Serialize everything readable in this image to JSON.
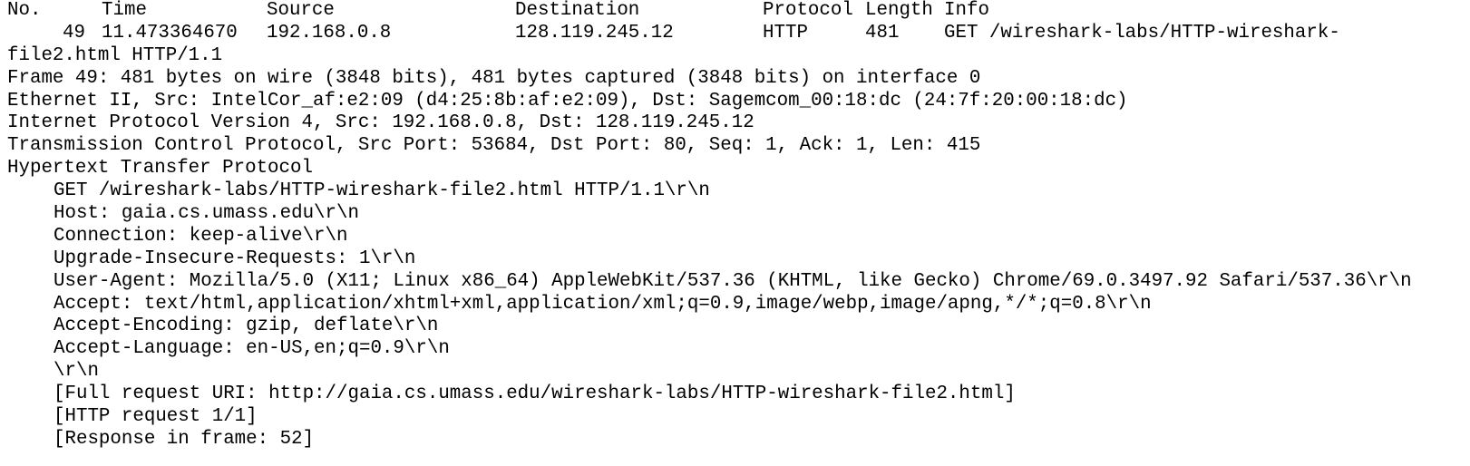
{
  "summary": {
    "headers": {
      "no": "No.",
      "time": "Time",
      "source": "Source",
      "destination": "Destination",
      "protocol": "Protocol",
      "length": "Length",
      "info": "Info"
    },
    "row": {
      "no": "49",
      "time": "11.473364670",
      "source": "192.168.0.8",
      "destination": "128.119.245.12",
      "protocol": "HTTP",
      "length": "481",
      "info": "GET /wireshark-labs/HTTP-wireshark-",
      "info_wrap": "file2.html HTTP/1.1"
    }
  },
  "details": {
    "frame": "Frame 49: 481 bytes on wire (3848 bits), 481 bytes captured (3848 bits) on interface 0",
    "ethernet": "Ethernet II, Src: IntelCor_af:e2:09 (d4:25:8b:af:e2:09), Dst: Sagemcom_00:18:dc (24:7f:20:00:18:dc)",
    "ip": "Internet Protocol Version 4, Src: 192.168.0.8, Dst: 128.119.245.12",
    "tcp": "Transmission Control Protocol, Src Port: 53684, Dst Port: 80, Seq: 1, Ack: 1, Len: 415",
    "http": "Hypertext Transfer Protocol",
    "http_fields": [
      "GET /wireshark-labs/HTTP-wireshark-file2.html HTTP/1.1\\r\\n",
      "Host: gaia.cs.umass.edu\\r\\n",
      "Connection: keep-alive\\r\\n",
      "Upgrade-Insecure-Requests: 1\\r\\n",
      "User-Agent: Mozilla/5.0 (X11; Linux x86_64) AppleWebKit/537.36 (KHTML, like Gecko) Chrome/69.0.3497.92 Safari/537.36\\r\\n",
      "Accept: text/html,application/xhtml+xml,application/xml;q=0.9,image/webp,image/apng,*/*;q=0.8\\r\\n",
      "Accept-Encoding: gzip, deflate\\r\\n",
      "Accept-Language: en-US,en;q=0.9\\r\\n",
      "\\r\\n",
      "[Full request URI: http://gaia.cs.umass.edu/wireshark-labs/HTTP-wireshark-file2.html]",
      "[HTTP request 1/1]",
      "[Response in frame: 52]"
    ]
  }
}
